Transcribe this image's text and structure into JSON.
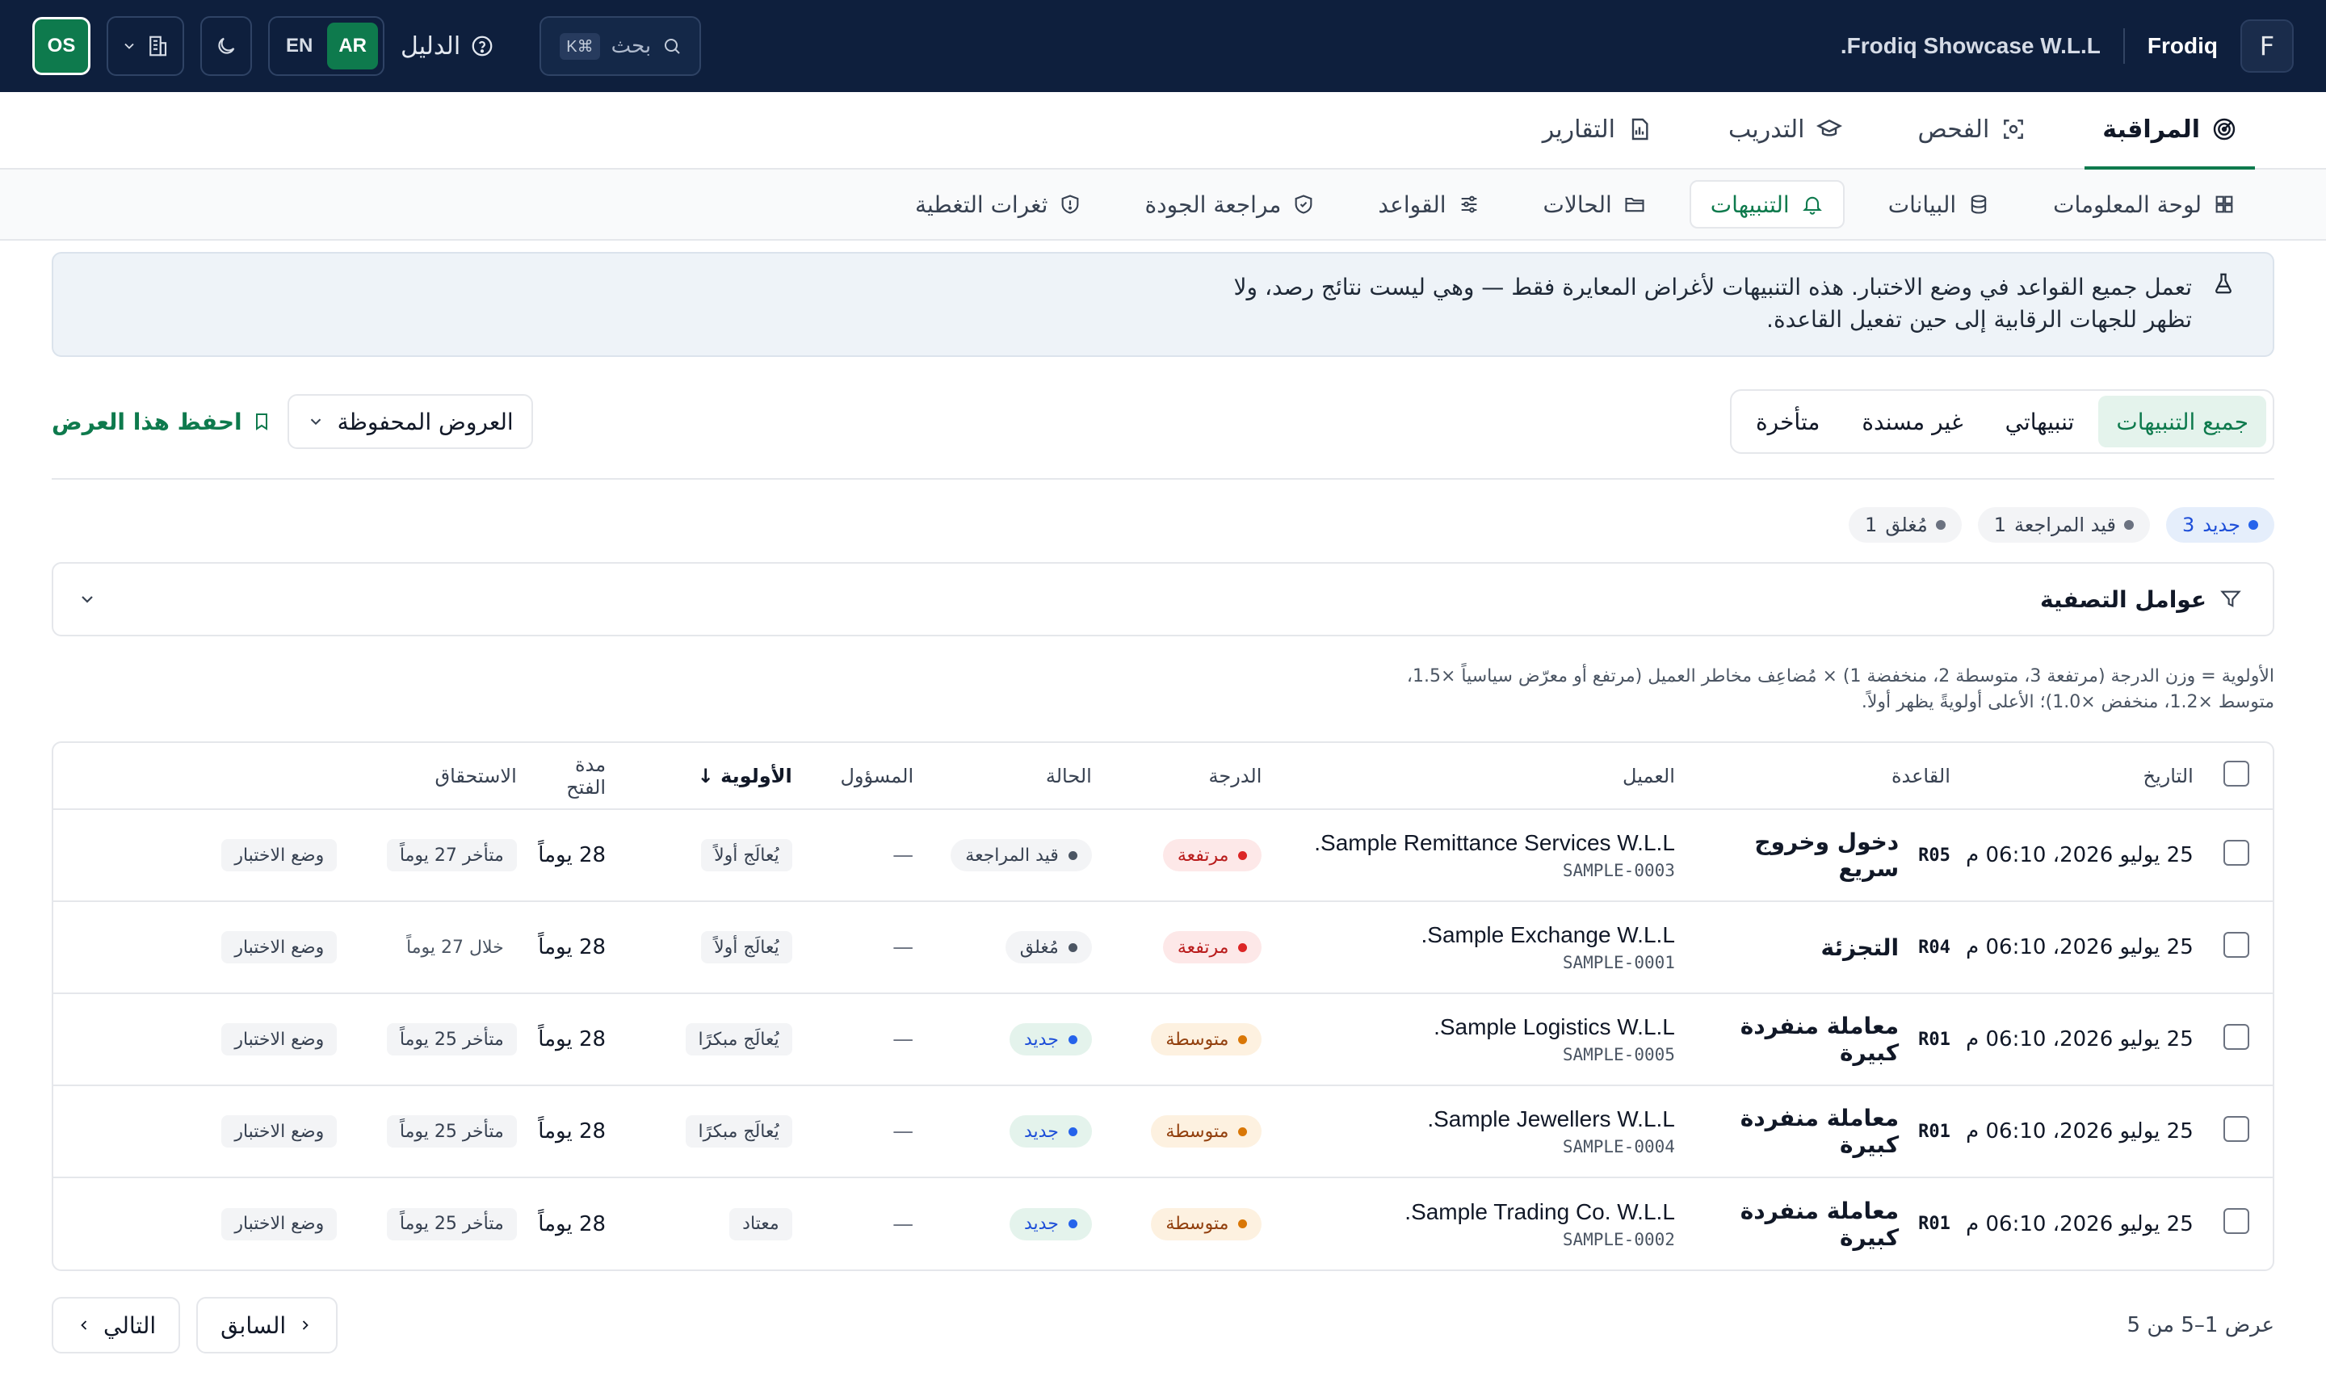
{
  "topbar": {
    "logo_letter": "F",
    "brand": "Frodiq",
    "company": "Frodiq Showcase W.L.L.",
    "search_label": "بحث",
    "search_shortcut": "⌘K",
    "guide_label": "الدليل",
    "lang_ar": "AR",
    "lang_en": "EN",
    "avatar": "OS"
  },
  "modules": [
    {
      "label": "المراقبة",
      "icon": "radar-icon",
      "active": true
    },
    {
      "label": "الفحص",
      "icon": "scan-icon"
    },
    {
      "label": "التدريب",
      "icon": "graduation-cap-icon"
    },
    {
      "label": "التقارير",
      "icon": "report-icon"
    }
  ],
  "subnav": [
    {
      "label": "لوحة المعلومات",
      "icon": "dashboard-icon"
    },
    {
      "label": "البيانات",
      "icon": "database-icon"
    },
    {
      "label": "التنبيهات",
      "icon": "bell-icon",
      "active": true
    },
    {
      "label": "الحالات",
      "icon": "folder-icon"
    },
    {
      "label": "القواعد",
      "icon": "sliders-icon"
    },
    {
      "label": "مراجعة الجودة",
      "icon": "shield-check-icon"
    },
    {
      "label": "ثغرات التغطية",
      "icon": "shield-alert-icon"
    }
  ],
  "banner": {
    "text": "تعمل جميع القواعد في وضع الاختبار. هذه التنبيهات لأغراض المعايرة فقط — وهي ليست نتائج رصد، ولا تظهر للجهات الرقابية إلى حين تفعيل القاعدة."
  },
  "views": {
    "tabs": [
      "جميع التنبيهات",
      "تنبيهاتي",
      "غير مسندة",
      "متأخرة"
    ],
    "saved_views": "العروض المحفوظة",
    "save_view": "احفظ هذا العرض"
  },
  "status_chips": [
    {
      "label": "جديد",
      "count": "3",
      "active": true
    },
    {
      "label": "قيد المراجعة",
      "count": "1"
    },
    {
      "label": "مُغلق",
      "count": "1"
    }
  ],
  "filters": {
    "label": "عوامل التصفية"
  },
  "priority_note": {
    "line1": "الأولوية = وزن الدرجة (مرتفعة 3، متوسطة 2، منخفضة 1) × مُضاعِف مخاطر العميل (مرتفع أو معرّض سياسياً ×1.5،",
    "line2": "متوسط ×1.2، منخفض ×1.0)؛ الأعلى أولويةً يظهر أولاً."
  },
  "table": {
    "headers": {
      "date": "التاريخ",
      "rule": "القاعدة",
      "client": "العميل",
      "severity": "الدرجة",
      "status": "الحالة",
      "assignee": "المسؤول",
      "priority": "الأولوية",
      "sort_arrow": "↓",
      "open_for": "مدة الفتح",
      "due": "الاستحقاق"
    },
    "rows": [
      {
        "date": "25 يوليو 2026، 06:10 م",
        "rule_code": "R05",
        "rule_name": "دخول وخروج سريع",
        "client_name": "Sample Remittance Services W.L.L.",
        "client_id": "SAMPLE-0003",
        "severity": "مرتفعة",
        "severity_kind": "high",
        "status": "قيد المراجعة",
        "status_kind": "neutral",
        "assignee": "—",
        "priority": "يُعالَج أولاً",
        "open_for": "28 يوماً",
        "due": "متأخر 27 يوماً",
        "due_kind": "late",
        "mode": "وضع الاختبار"
      },
      {
        "date": "25 يوليو 2026، 06:10 م",
        "rule_code": "R04",
        "rule_name": "التجزئة",
        "client_name": "Sample Exchange W.L.L.",
        "client_id": "SAMPLE-0001",
        "severity": "مرتفعة",
        "severity_kind": "high",
        "status": "مُغلق",
        "status_kind": "closed",
        "assignee": "—",
        "priority": "يُعالَج أولاً",
        "open_for": "28 يوماً",
        "due": "خلال 27 يوماً",
        "due_kind": "plain",
        "mode": "وضع الاختبار"
      },
      {
        "date": "25 يوليو 2026، 06:10 م",
        "rule_code": "R01",
        "rule_name": "معاملة منفردة كبيرة",
        "client_name": "Sample Logistics W.L.L.",
        "client_id": "SAMPLE-0005",
        "severity": "متوسطة",
        "severity_kind": "med",
        "status": "جديد",
        "status_kind": "new",
        "assignee": "—",
        "priority": "يُعالَج مبكرًا",
        "open_for": "28 يوماً",
        "due": "متأخر 25 يوماً",
        "due_kind": "late",
        "mode": "وضع الاختبار"
      },
      {
        "date": "25 يوليو 2026، 06:10 م",
        "rule_code": "R01",
        "rule_name": "معاملة منفردة كبيرة",
        "client_name": "Sample Jewellers W.L.L.",
        "client_id": "SAMPLE-0004",
        "severity": "متوسطة",
        "severity_kind": "med",
        "status": "جديد",
        "status_kind": "new",
        "assignee": "—",
        "priority": "يُعالَج مبكرًا",
        "open_for": "28 يوماً",
        "due": "متأخر 25 يوماً",
        "due_kind": "late",
        "mode": "وضع الاختبار"
      },
      {
        "date": "25 يوليو 2026، 06:10 م",
        "rule_code": "R01",
        "rule_name": "معاملة منفردة كبيرة",
        "client_name": "Sample Trading Co. W.L.L.",
        "client_id": "SAMPLE-0002",
        "severity": "متوسطة",
        "severity_kind": "med",
        "status": "جديد",
        "status_kind": "new",
        "assignee": "—",
        "priority": "معتاد",
        "open_for": "28 يوماً",
        "due": "متأخر 25 يوماً",
        "due_kind": "late",
        "mode": "وضع الاختبار"
      }
    ]
  },
  "pagination": {
    "count": "عرض 1–5 من 5",
    "prev": "السابق",
    "next": "التالي"
  },
  "colors": {
    "topbar_bg": "#0e1f3d",
    "accent": "#0e7a4d",
    "high": "#dc2626",
    "medium": "#d97706",
    "new": "#2563eb"
  }
}
